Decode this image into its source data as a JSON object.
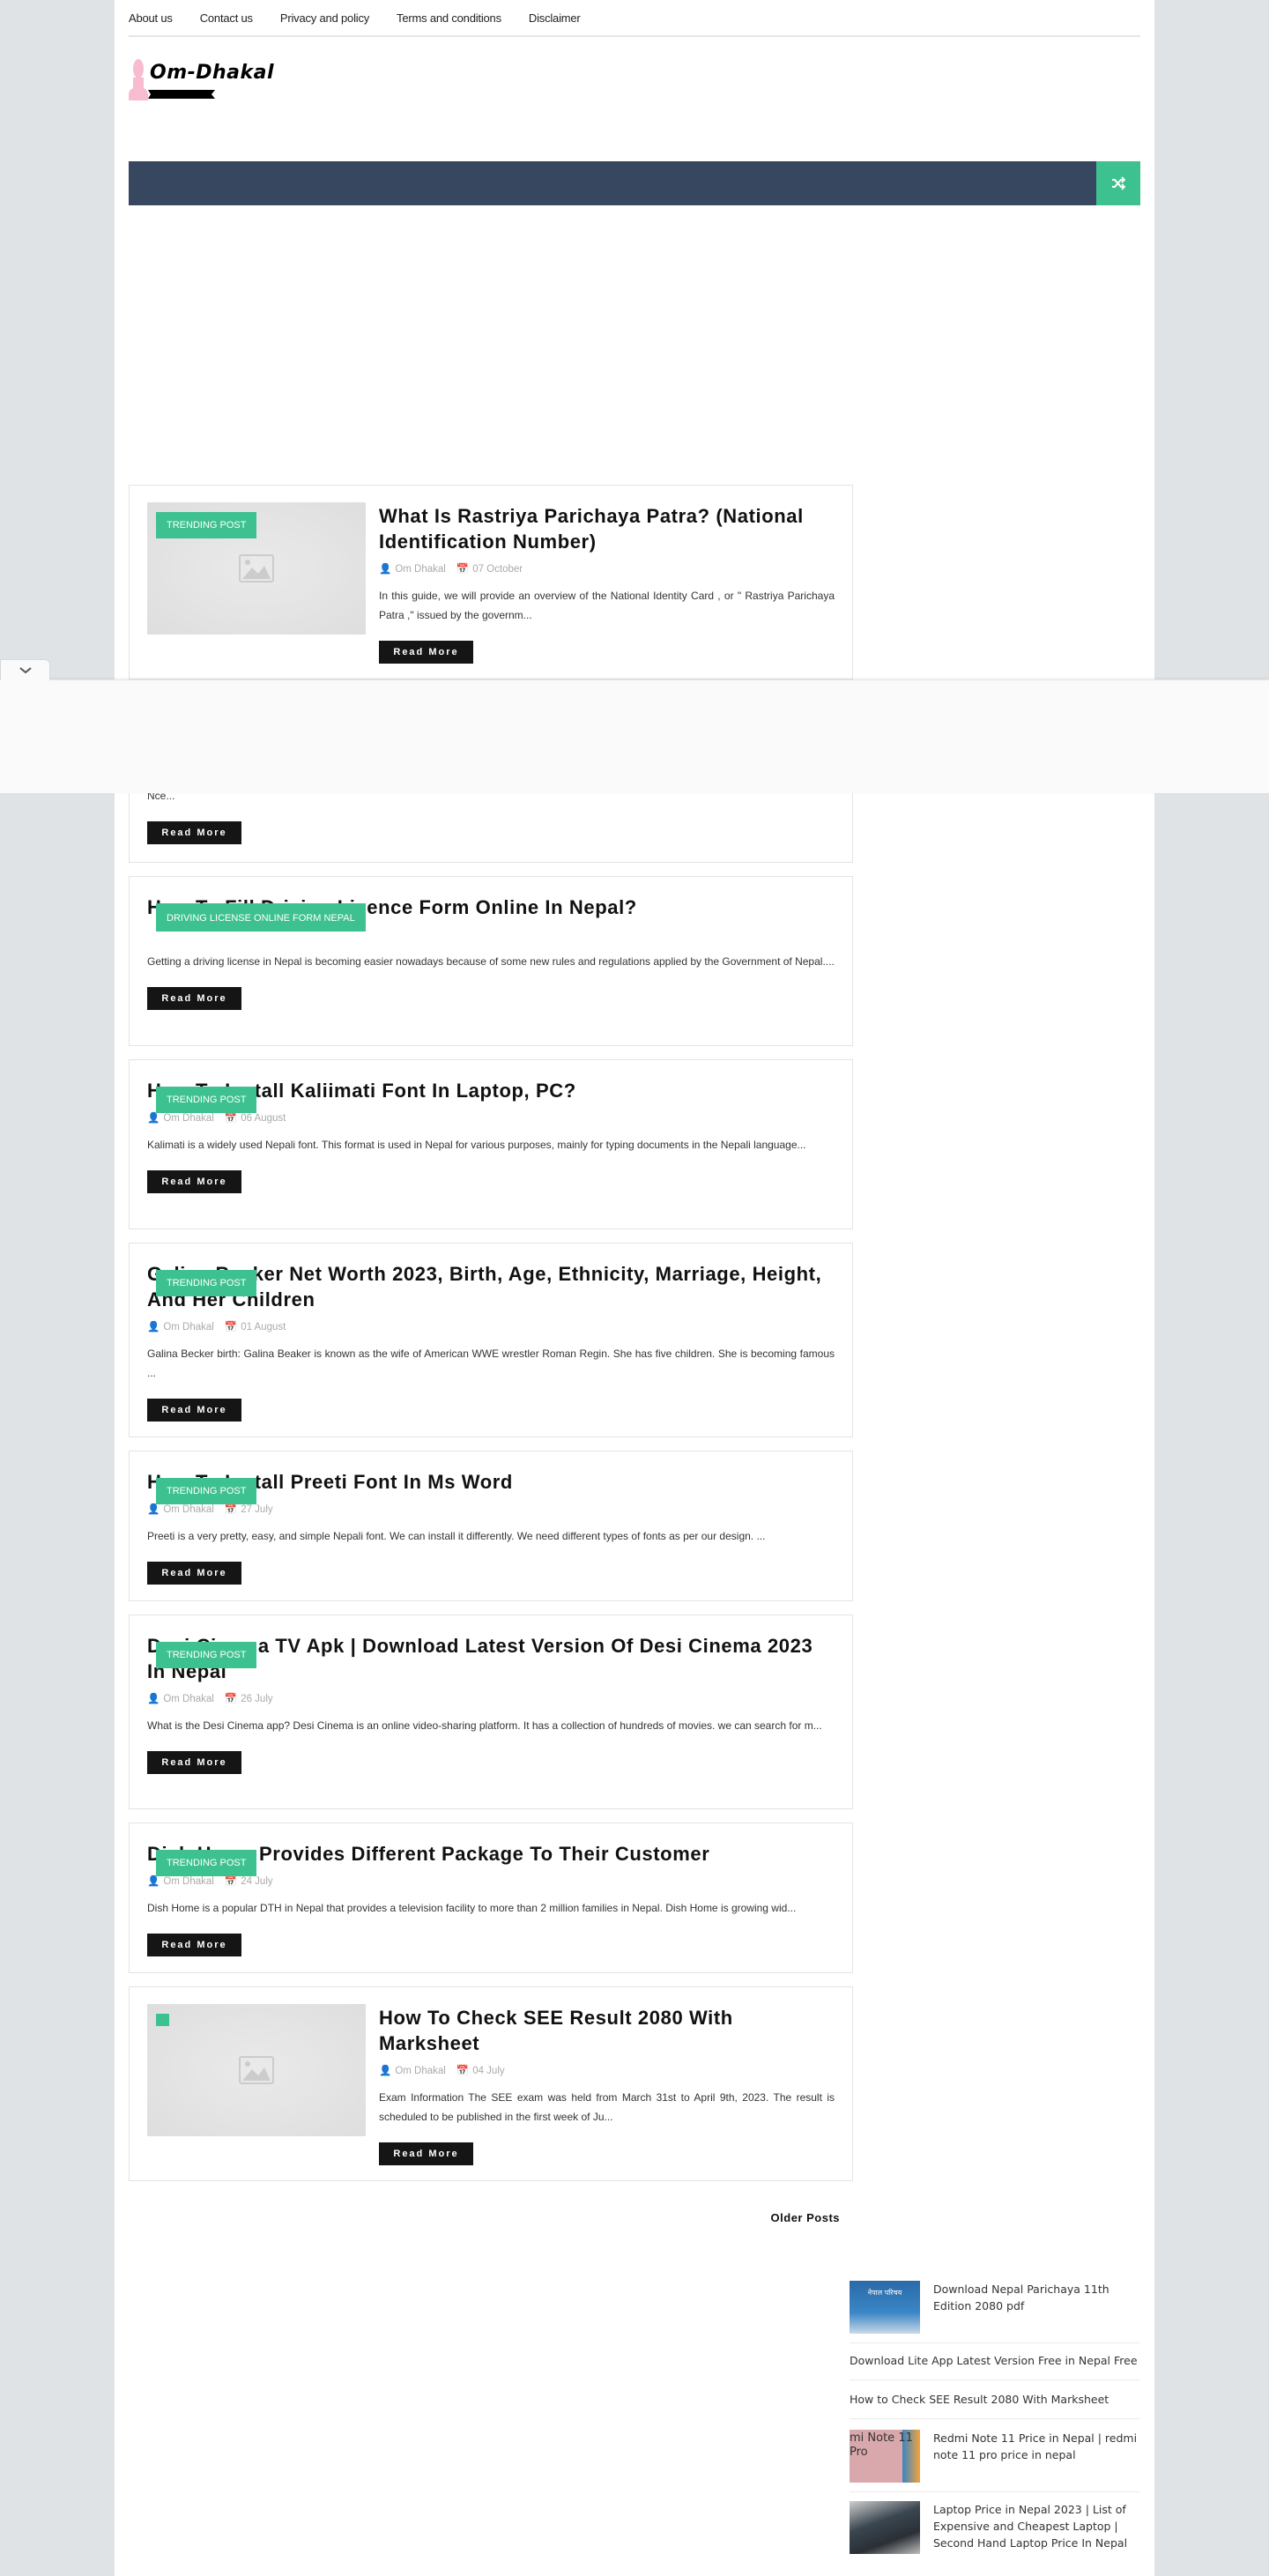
{
  "topnav": [
    "About us",
    "Contact us",
    "Privacy and policy",
    "Terms and conditions",
    "Disclaimer"
  ],
  "logo": {
    "text": "Om-Dhakal"
  },
  "colors": {
    "accent": "#3dc191",
    "navbar": "#374760",
    "button": "#151515"
  },
  "read_more": "Read More",
  "posts": [
    {
      "badge": "Trending Post",
      "title": "What Is Rastriya Parichaya Patra? (National Identification Number)",
      "author": "Om Dhakal",
      "date": "07 October",
      "excerpt": "In this guide, we will provide an overview of the  National Identity Card , or \" Rastriya Parichaya Patra ,\" issued by the governm...",
      "thumb": true
    },
    {
      "excerpt": "Nce..."
    },
    {
      "badge": "Driving License Online Form Nepal",
      "title": "How To Fill Driving Licence Form Online In Nepal?",
      "excerpt": "Getting a driving license in Nepal is becoming easier nowadays because of some new rules and regulations applied by the Government of Nepal...."
    },
    {
      "badge": "Trending Post",
      "title": "How To Install Kaliimati Font In Laptop, PC?",
      "author": "Om Dhakal",
      "date": "06 August",
      "excerpt": "Kalimati is a widely used Nepali font. This format is used in Nepal for various purposes, mainly for typing documents in the Nepali language..."
    },
    {
      "badge": "Trending Post",
      "title": "Galina Becker Net Worth 2023, Birth, Age, Ethnicity, Marriage, Height, And Her Children",
      "author": "Om Dhakal",
      "date": "01 August",
      "excerpt": "Galina Becker birth: Galina Beaker is known as the wife of American WWE wrestler Roman Regin. She has five children. She is becoming famous ..."
    },
    {
      "badge": "Trending Post",
      "title": "How To Install Preeti Font In Ms Word",
      "author": "Om Dhakal",
      "date": "27 July",
      "excerpt": "Preeti is a very pretty, easy, and simple Nepali font. We can install it differently. We need different types of fonts as per our design. ..."
    },
    {
      "badge": "Trending Post",
      "title": "Desi Cinema TV Apk | Download Latest Version Of Desi Cinema 2023 In Nepal",
      "author": "Om Dhakal",
      "date": "26 July",
      "excerpt": "What is the Desi Cinema app? Desi Cinema is an online video-sharing platform. It has a collection of hundreds of movies. we can search for m..."
    },
    {
      "badge": "Trending Post",
      "title": "Dish Home Provides Different Package To Their Customer",
      "author": "Om Dhakal",
      "date": "24 July",
      "excerpt": " Dish Home is a popular DTH in Nepal that provides a television facility to more than 2 million families in Nepal. Dish Home is growing wid..."
    },
    {
      "title": "How To Check SEE Result 2080 With Marksheet",
      "author": "Om Dhakal",
      "date": "04 July",
      "excerpt": "Exam Information The SEE exam was held from March 31st to April 9th, 2023. The result is scheduled to be published in the first week of Ju...",
      "thumb": true
    }
  ],
  "older_posts": "Older Posts",
  "sidebar": [
    {
      "title": "Download Nepal Parichaya 11th Edition 2080 pdf",
      "thumb_text": "नेपाल परिचय"
    },
    {
      "title": "Download Lite App Latest Version Free in Nepal Free"
    },
    {
      "title": "How to Check SEE Result 2080 With Marksheet"
    },
    {
      "title": "Redmi Note 11 Price in Nepal | redmi note 11 pro price in nepal",
      "thumb_text": "mi Note 11 Pro"
    },
    {
      "title": "Laptop Price in Nepal 2023 | List of Expensive and Cheapest Laptop | Second Hand Laptop Price In Nepal"
    }
  ]
}
